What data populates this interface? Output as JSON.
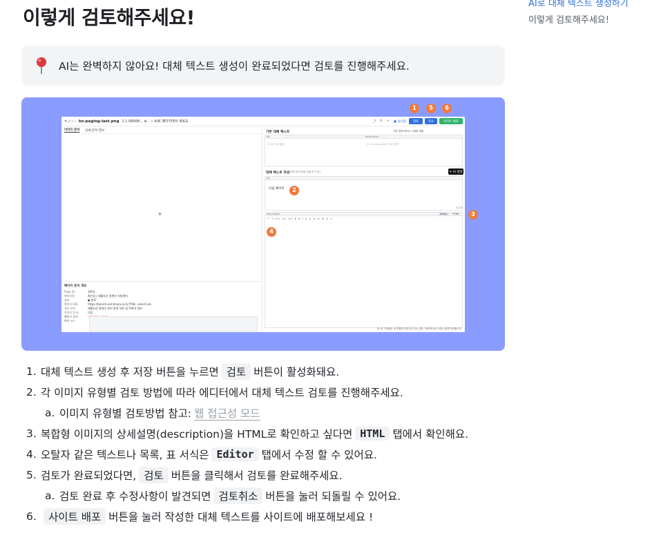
{
  "page": {
    "title": "이렇게 검토해주세요!"
  },
  "toc": {
    "link_label": "AI로 대체 텍스트 생성하기",
    "current_label": "이렇게 검토해주세요!"
  },
  "callout": {
    "icon": "pin-icon",
    "text": "AI는 완벽하지 않아요! 대체 텍스트 생성이 완료되었다면 검토를 진행해주세요."
  },
  "screenshot": {
    "filename": "ko-paging-last.png",
    "toolbar_info": "1.1 66668... ⊕  · ☆ AI로 페이지에서 새로도",
    "buttons": {
      "review": "검토",
      "cancel": "취소",
      "deploy": "사이트 배포",
      "status": "● 승인됨"
    },
    "tabs": {
      "active": "이미지 분석",
      "inactive": "상세 분석 정보"
    },
    "expand_symbol": "»",
    "right_top_title": "기존 대체 텍스트",
    "right_top_action": "기존 대체 텍스트 그대로 적용",
    "alt_label": "alt",
    "description_label": "description",
    "alt_placeholder": "무 alt 속성 없음",
    "desc_placeholder": "무 alt-description 속성 없음",
    "write_title": "대체 텍스트 작성",
    "write_hint": "(현재 입력 편집 허용 보기 중)",
    "ai_button": "✦ AI 생성",
    "alt_value": "다음 페이지",
    "counter": "4/150",
    "desc_tabs": {
      "editor": "Editor",
      "html": "HTML"
    },
    "meta_title": "페이지 분석 개요",
    "meta_rows": [
      {
        "k": "Page ID",
        "v": "1903"
      },
      {
        "k": "페이지명",
        "v": "최신업 | 재활부산 장애인 자원센터"
      },
      {
        "k": "결과",
        "v": "● 완료"
      },
      {
        "k": "페이지 URL",
        "v": "https://barodi.somimory.co.kr/?f48...search.do"
      },
      {
        "k": "생성 요약",
        "v": "재활부산 장애인 센터 관련 자료 및 목록과 정보"
      },
      {
        "k": "이미지 정 요구",
        "v": "다음"
      },
      {
        "k": "대체가 클래스",
        "v": ".direction_last"
      },
      {
        "k": "주변 코드",
        "v": ""
      }
    ],
    "footnote": "참 제 가 예제는 내 포함한 이미지이 있는 경우, 대체 텍스트 수정시 항목 안내합니다."
  },
  "badges": [
    "1",
    "5",
    "6",
    "2",
    "3",
    "4"
  ],
  "steps": [
    {
      "num": "1.",
      "before": "대체 텍스트 생성 후  저장 버튼을 누르면",
      "chip": "검토",
      "after": "버튼이 활성화돼요."
    },
    {
      "num": "2.",
      "text": "각 이미지 유형별 검토 방법에 따라 에디터에서 대체 텍스트 검토를 진행해주세요."
    },
    {
      "num": "a.",
      "before": "이미지 유형별 검토방법 참고:",
      "link": "웹 접근성 모드"
    },
    {
      "num": "3.",
      "before": "복합형 이미지의 상세설명(description)을 HTML로 확인하고 싶다면",
      "code": "HTML",
      "after": "탭에서 확인해요."
    },
    {
      "num": "4.",
      "before": "오탈자 같은 텍스트나 목록, 표 서식은",
      "code": "Editor",
      "after": "탭에서 수정 할 수 있어요."
    },
    {
      "num": "5.",
      "before": "검토가 완료되었다면,",
      "chip": "검토",
      "after": "버튼을 클릭해서 검토를 완료해주세요."
    },
    {
      "num": "a.",
      "before": "검토 완료 후 수정사항이 발견되면",
      "chip": "검토취소",
      "after": "버튼을 눌러 되돌릴 수 있어요."
    },
    {
      "num": "6.",
      "chip": "사이트 배포",
      "after": "버튼을 눌러 작성한 대체 텍스트를 사이트에 배포해보세요 !"
    }
  ],
  "colors": {
    "hero_bg": "#8a9cff",
    "badge": "#f07a3b",
    "accent_link": "#2f6fde",
    "review_btn": "#2f6fde",
    "deploy_btn": "#2fb36b"
  }
}
